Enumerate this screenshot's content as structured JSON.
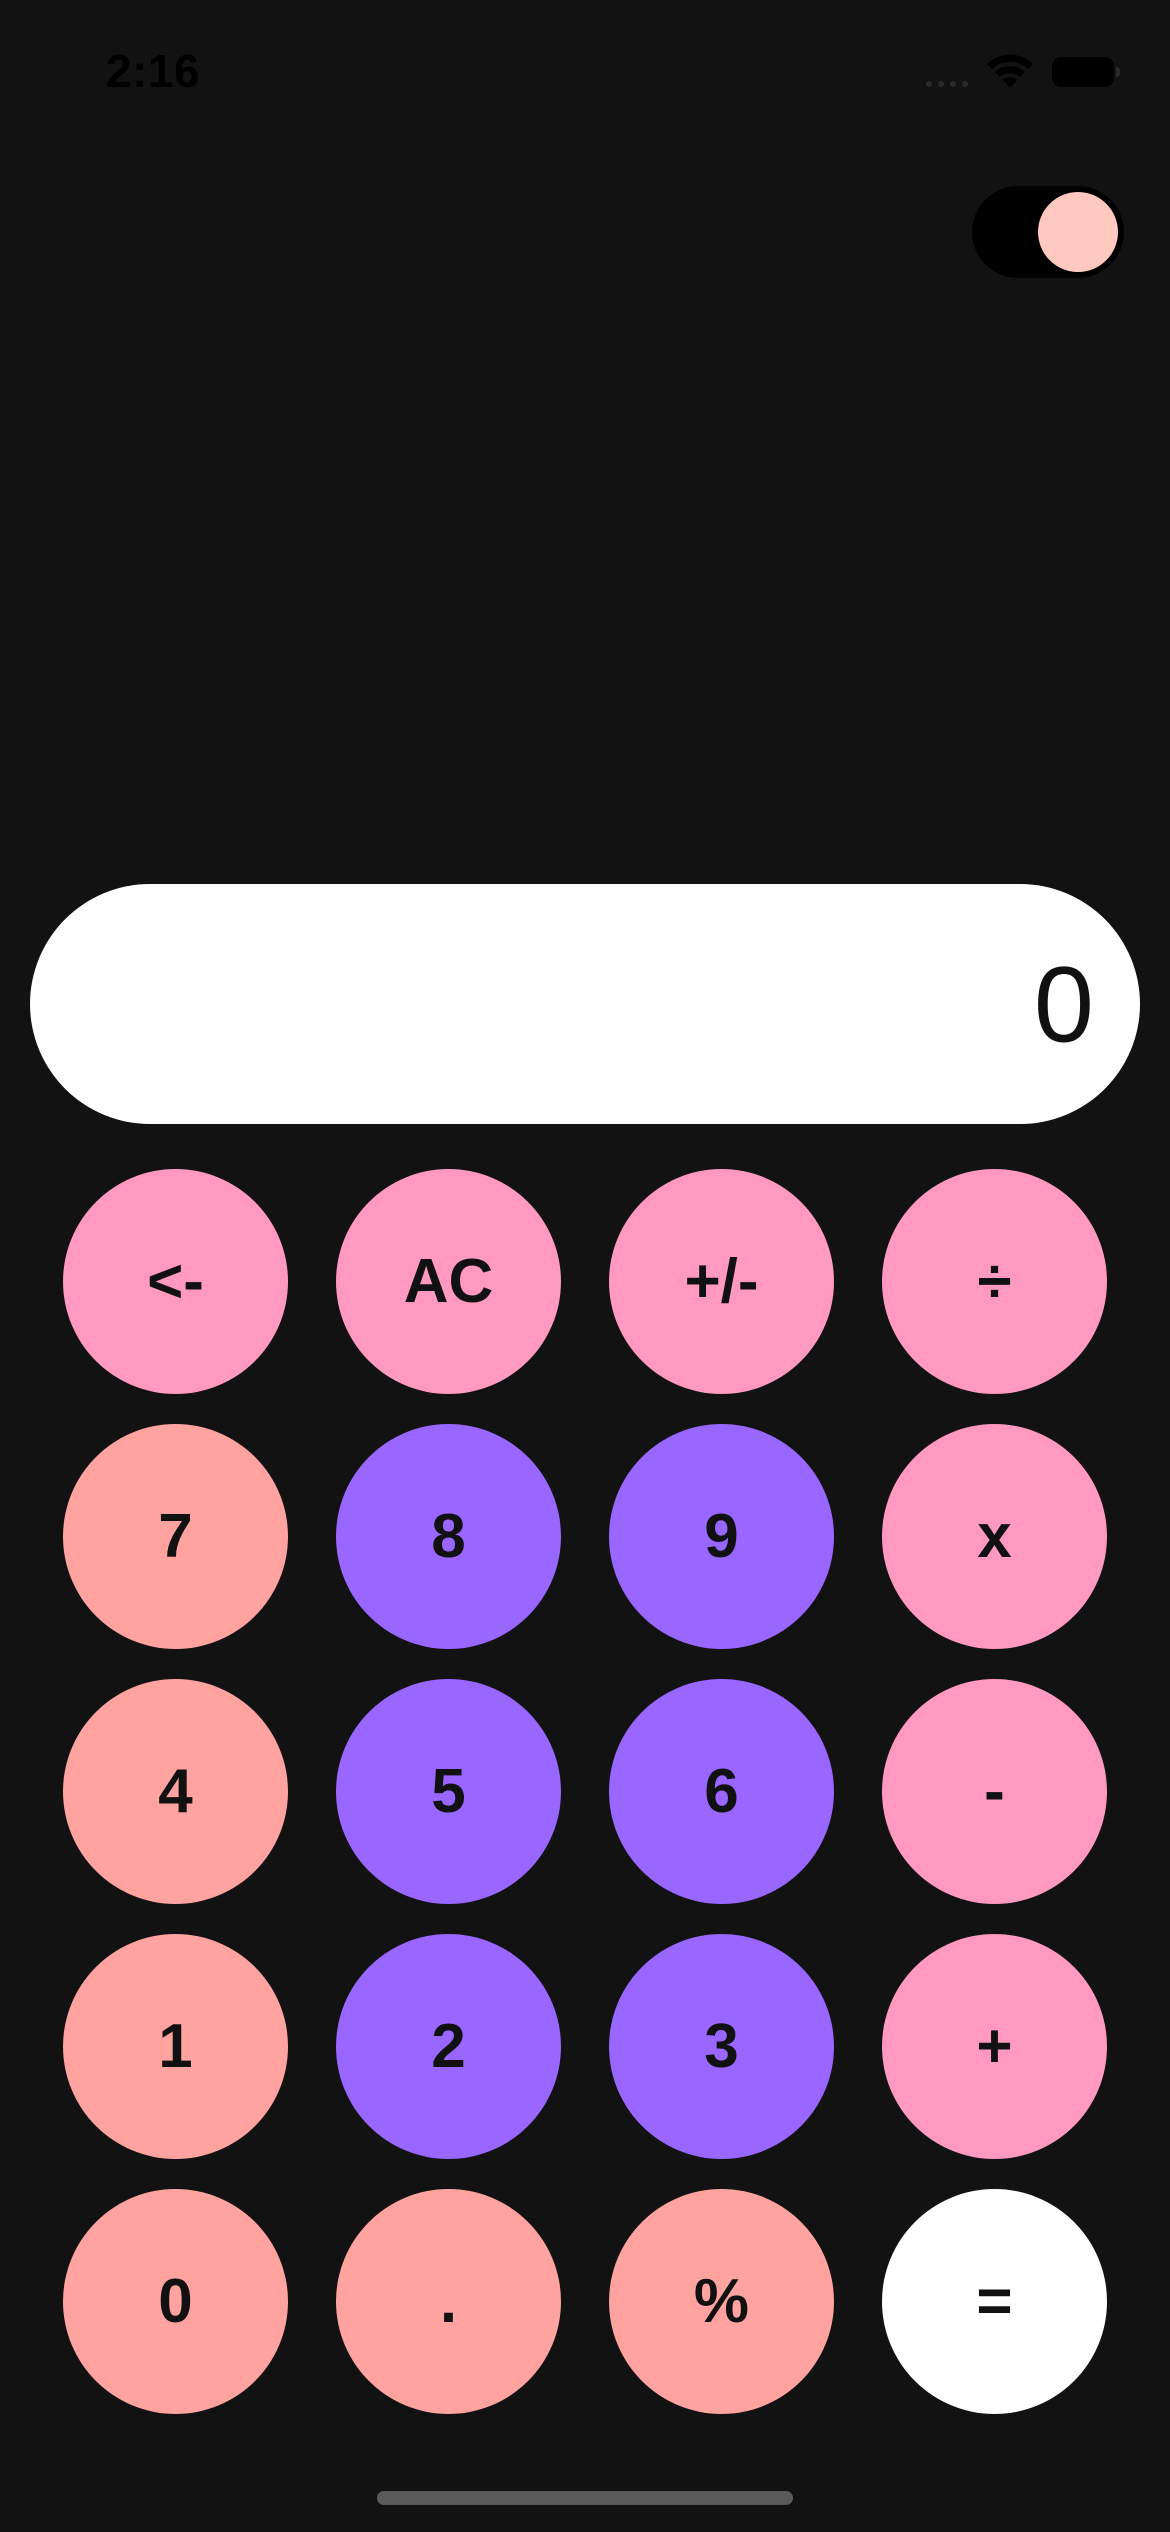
{
  "status_bar": {
    "time": "2:16",
    "icons": [
      "signal-icon",
      "wifi-icon",
      "battery-icon"
    ]
  },
  "theme_toggle": {
    "state": "on",
    "knob_color": "#FFC9BF",
    "track_color": "#000000"
  },
  "display": {
    "value": "0"
  },
  "colors": {
    "background": "#121212",
    "function_key": "#FF99C0",
    "number_key_coral": "#FFA3A1",
    "number_key_violet": "#9966FF",
    "equals_key": "#FFFFFF",
    "key_text": "#111111"
  },
  "keys": [
    {
      "label": "<-",
      "name": "backspace-button",
      "color": "#FF99C0"
    },
    {
      "label": "AC",
      "name": "clear-button",
      "color": "#FF99C0"
    },
    {
      "label": "+/-",
      "name": "sign-toggle-button",
      "color": "#FF99C0"
    },
    {
      "label": "÷",
      "name": "divide-button",
      "color": "#FF99C0"
    },
    {
      "label": "7",
      "name": "digit-7-button",
      "color": "#FFA3A1"
    },
    {
      "label": "8",
      "name": "digit-8-button",
      "color": "#9966FF"
    },
    {
      "label": "9",
      "name": "digit-9-button",
      "color": "#9966FF"
    },
    {
      "label": "x",
      "name": "multiply-button",
      "color": "#FF99C0"
    },
    {
      "label": "4",
      "name": "digit-4-button",
      "color": "#FFA3A1"
    },
    {
      "label": "5",
      "name": "digit-5-button",
      "color": "#9966FF"
    },
    {
      "label": "6",
      "name": "digit-6-button",
      "color": "#9966FF"
    },
    {
      "label": "-",
      "name": "subtract-button",
      "color": "#FF99C0"
    },
    {
      "label": "1",
      "name": "digit-1-button",
      "color": "#FFA3A1"
    },
    {
      "label": "2",
      "name": "digit-2-button",
      "color": "#9966FF"
    },
    {
      "label": "3",
      "name": "digit-3-button",
      "color": "#9966FF"
    },
    {
      "label": "+",
      "name": "add-button",
      "color": "#FF99C0"
    },
    {
      "label": "0",
      "name": "digit-0-button",
      "color": "#FFA3A1"
    },
    {
      "label": ".",
      "name": "decimal-button",
      "color": "#FFA3A1"
    },
    {
      "label": "%",
      "name": "percent-button",
      "color": "#FFA3A1"
    },
    {
      "label": "=",
      "name": "equals-button",
      "color": "#FFFFFF"
    }
  ]
}
